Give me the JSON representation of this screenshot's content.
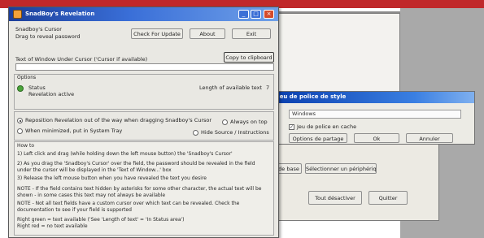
{
  "background": {
    "dialog_title": "Jeu de police de style",
    "font_field_value": "Windows",
    "checkbox_label": "Jeu de police en cache",
    "buttons": [
      "Options de partage",
      "Ok",
      "Annuler"
    ],
    "left_buttons": [
      "de base",
      "Sélectionner un périphérique"
    ],
    "bottom_buttons": [
      "Tout désactiver",
      "Quitter"
    ]
  },
  "main_window": {
    "title": "SnadBoy's Revelation",
    "controls": {
      "minimize": "_",
      "maximize": "□",
      "close": "×"
    },
    "target_label": "Snadboy's Cursor",
    "drag_hint": "Drag to reveal password",
    "buttons": {
      "check_update": "Check For Update",
      "about": "About",
      "exit": "Exit"
    },
    "text_label": "Text of Window Under Cursor ('Cursor if available)",
    "copy_button": "Copy to clipboard",
    "status_group": "Options",
    "status_label": "Status",
    "status_value": "Revelation active",
    "length_label": "Length of available text",
    "length_value": "7",
    "options": {
      "reposition": "Reposition Revelation out of the way when dragging Snadboy's Cursor",
      "always_on_top": "Always on top",
      "minimize_tray": "When minimized, put in System Tray",
      "hide_source": "Hide Source / Instructions"
    },
    "instructions": [
      "How to",
      "1) Left click and drag (while holding down the left mouse button) the 'Snadboy's Cursor'",
      "2) As you drag the 'Snadboy's Cursor' over the field, the password should be revealed in the field",
      "    under the cursor will be displayed in the 'Text of Window...' box",
      "3) Release the left mouse button when you have revealed the text you desire",
      "NOTE - If the field contains text hidden by asterisks for some other character, the actual text will be",
      "    shown - in some cases this text may not always be available",
      "NOTE - Not all text fields have a custom cursor over which text can be revealed. Check the",
      "    documentation to see if your field is supported",
      "Right green = text available ('See 'Length of text' = 'In Status area')",
      "Right red = no text available"
    ]
  },
  "colors": {
    "title_bar": "#1c3f9a",
    "status_ok": "#4aa53a",
    "header_band": "#c0282a"
  }
}
